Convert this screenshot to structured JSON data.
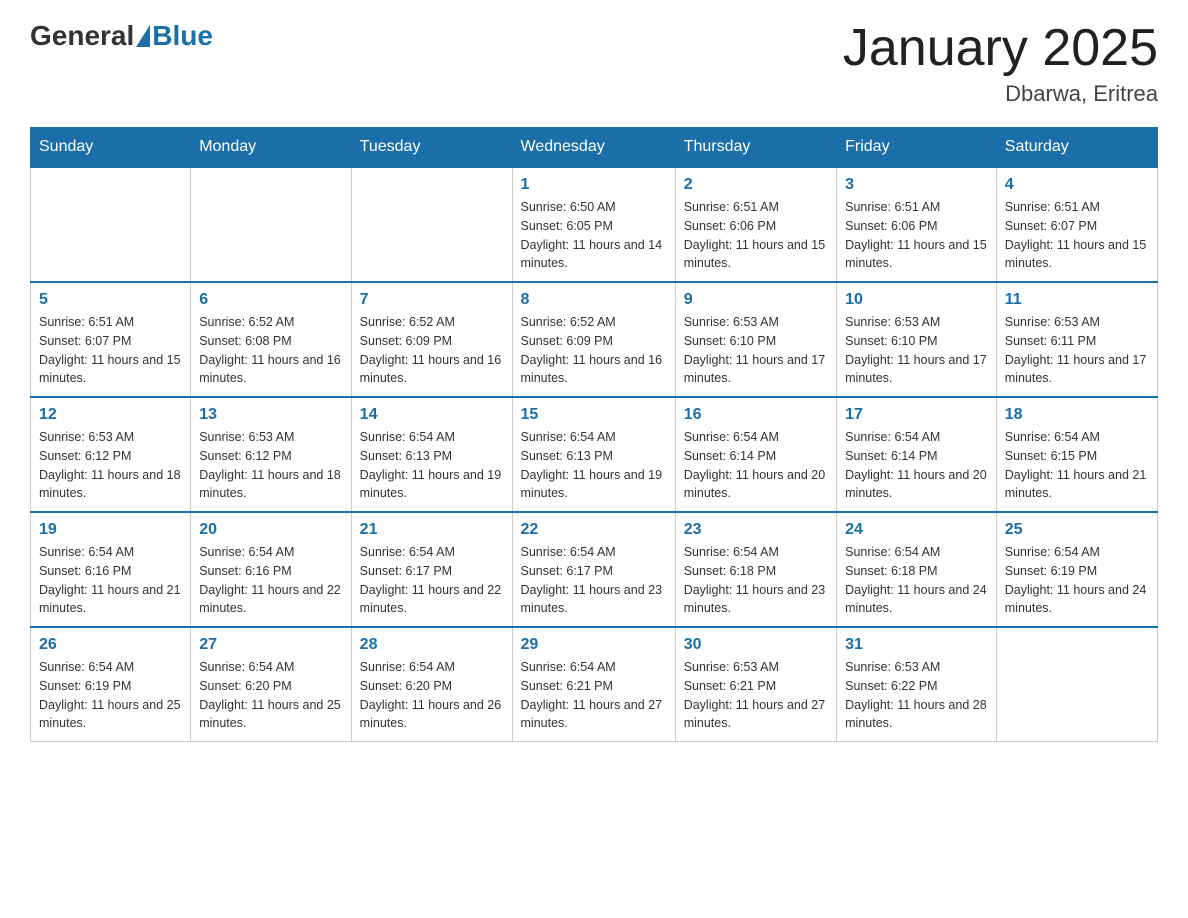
{
  "header": {
    "logo_general": "General",
    "logo_blue": "Blue",
    "month_title": "January 2025",
    "location": "Dbarwa, Eritrea"
  },
  "days_of_week": [
    "Sunday",
    "Monday",
    "Tuesday",
    "Wednesday",
    "Thursday",
    "Friday",
    "Saturday"
  ],
  "weeks": [
    [
      {
        "day": "",
        "sunrise": "",
        "sunset": "",
        "daylight": ""
      },
      {
        "day": "",
        "sunrise": "",
        "sunset": "",
        "daylight": ""
      },
      {
        "day": "",
        "sunrise": "",
        "sunset": "",
        "daylight": ""
      },
      {
        "day": "1",
        "sunrise": "Sunrise: 6:50 AM",
        "sunset": "Sunset: 6:05 PM",
        "daylight": "Daylight: 11 hours and 14 minutes."
      },
      {
        "day": "2",
        "sunrise": "Sunrise: 6:51 AM",
        "sunset": "Sunset: 6:06 PM",
        "daylight": "Daylight: 11 hours and 15 minutes."
      },
      {
        "day": "3",
        "sunrise": "Sunrise: 6:51 AM",
        "sunset": "Sunset: 6:06 PM",
        "daylight": "Daylight: 11 hours and 15 minutes."
      },
      {
        "day": "4",
        "sunrise": "Sunrise: 6:51 AM",
        "sunset": "Sunset: 6:07 PM",
        "daylight": "Daylight: 11 hours and 15 minutes."
      }
    ],
    [
      {
        "day": "5",
        "sunrise": "Sunrise: 6:51 AM",
        "sunset": "Sunset: 6:07 PM",
        "daylight": "Daylight: 11 hours and 15 minutes."
      },
      {
        "day": "6",
        "sunrise": "Sunrise: 6:52 AM",
        "sunset": "Sunset: 6:08 PM",
        "daylight": "Daylight: 11 hours and 16 minutes."
      },
      {
        "day": "7",
        "sunrise": "Sunrise: 6:52 AM",
        "sunset": "Sunset: 6:09 PM",
        "daylight": "Daylight: 11 hours and 16 minutes."
      },
      {
        "day": "8",
        "sunrise": "Sunrise: 6:52 AM",
        "sunset": "Sunset: 6:09 PM",
        "daylight": "Daylight: 11 hours and 16 minutes."
      },
      {
        "day": "9",
        "sunrise": "Sunrise: 6:53 AM",
        "sunset": "Sunset: 6:10 PM",
        "daylight": "Daylight: 11 hours and 17 minutes."
      },
      {
        "day": "10",
        "sunrise": "Sunrise: 6:53 AM",
        "sunset": "Sunset: 6:10 PM",
        "daylight": "Daylight: 11 hours and 17 minutes."
      },
      {
        "day": "11",
        "sunrise": "Sunrise: 6:53 AM",
        "sunset": "Sunset: 6:11 PM",
        "daylight": "Daylight: 11 hours and 17 minutes."
      }
    ],
    [
      {
        "day": "12",
        "sunrise": "Sunrise: 6:53 AM",
        "sunset": "Sunset: 6:12 PM",
        "daylight": "Daylight: 11 hours and 18 minutes."
      },
      {
        "day": "13",
        "sunrise": "Sunrise: 6:53 AM",
        "sunset": "Sunset: 6:12 PM",
        "daylight": "Daylight: 11 hours and 18 minutes."
      },
      {
        "day": "14",
        "sunrise": "Sunrise: 6:54 AM",
        "sunset": "Sunset: 6:13 PM",
        "daylight": "Daylight: 11 hours and 19 minutes."
      },
      {
        "day": "15",
        "sunrise": "Sunrise: 6:54 AM",
        "sunset": "Sunset: 6:13 PM",
        "daylight": "Daylight: 11 hours and 19 minutes."
      },
      {
        "day": "16",
        "sunrise": "Sunrise: 6:54 AM",
        "sunset": "Sunset: 6:14 PM",
        "daylight": "Daylight: 11 hours and 20 minutes."
      },
      {
        "day": "17",
        "sunrise": "Sunrise: 6:54 AM",
        "sunset": "Sunset: 6:14 PM",
        "daylight": "Daylight: 11 hours and 20 minutes."
      },
      {
        "day": "18",
        "sunrise": "Sunrise: 6:54 AM",
        "sunset": "Sunset: 6:15 PM",
        "daylight": "Daylight: 11 hours and 21 minutes."
      }
    ],
    [
      {
        "day": "19",
        "sunrise": "Sunrise: 6:54 AM",
        "sunset": "Sunset: 6:16 PM",
        "daylight": "Daylight: 11 hours and 21 minutes."
      },
      {
        "day": "20",
        "sunrise": "Sunrise: 6:54 AM",
        "sunset": "Sunset: 6:16 PM",
        "daylight": "Daylight: 11 hours and 22 minutes."
      },
      {
        "day": "21",
        "sunrise": "Sunrise: 6:54 AM",
        "sunset": "Sunset: 6:17 PM",
        "daylight": "Daylight: 11 hours and 22 minutes."
      },
      {
        "day": "22",
        "sunrise": "Sunrise: 6:54 AM",
        "sunset": "Sunset: 6:17 PM",
        "daylight": "Daylight: 11 hours and 23 minutes."
      },
      {
        "day": "23",
        "sunrise": "Sunrise: 6:54 AM",
        "sunset": "Sunset: 6:18 PM",
        "daylight": "Daylight: 11 hours and 23 minutes."
      },
      {
        "day": "24",
        "sunrise": "Sunrise: 6:54 AM",
        "sunset": "Sunset: 6:18 PM",
        "daylight": "Daylight: 11 hours and 24 minutes."
      },
      {
        "day": "25",
        "sunrise": "Sunrise: 6:54 AM",
        "sunset": "Sunset: 6:19 PM",
        "daylight": "Daylight: 11 hours and 24 minutes."
      }
    ],
    [
      {
        "day": "26",
        "sunrise": "Sunrise: 6:54 AM",
        "sunset": "Sunset: 6:19 PM",
        "daylight": "Daylight: 11 hours and 25 minutes."
      },
      {
        "day": "27",
        "sunrise": "Sunrise: 6:54 AM",
        "sunset": "Sunset: 6:20 PM",
        "daylight": "Daylight: 11 hours and 25 minutes."
      },
      {
        "day": "28",
        "sunrise": "Sunrise: 6:54 AM",
        "sunset": "Sunset: 6:20 PM",
        "daylight": "Daylight: 11 hours and 26 minutes."
      },
      {
        "day": "29",
        "sunrise": "Sunrise: 6:54 AM",
        "sunset": "Sunset: 6:21 PM",
        "daylight": "Daylight: 11 hours and 27 minutes."
      },
      {
        "day": "30",
        "sunrise": "Sunrise: 6:53 AM",
        "sunset": "Sunset: 6:21 PM",
        "daylight": "Daylight: 11 hours and 27 minutes."
      },
      {
        "day": "31",
        "sunrise": "Sunrise: 6:53 AM",
        "sunset": "Sunset: 6:22 PM",
        "daylight": "Daylight: 11 hours and 28 minutes."
      },
      {
        "day": "",
        "sunrise": "",
        "sunset": "",
        "daylight": ""
      }
    ]
  ]
}
